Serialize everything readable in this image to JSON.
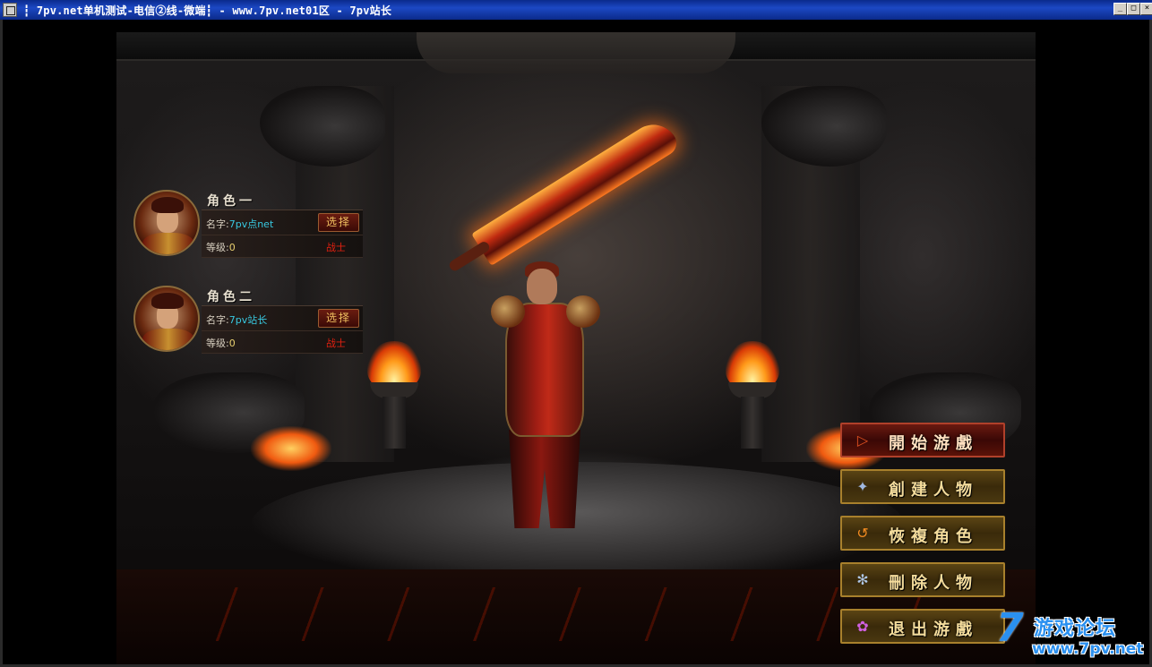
{
  "window": {
    "title": "┇  7pv.net单机测试-电信②线-微端┇ - www.7pv.net01区 - 7pv站长",
    "minimize": "_",
    "maximize": "□",
    "close": "×"
  },
  "characters": [
    {
      "title": "角色一",
      "name_label": "名字:",
      "name": "7pv点net",
      "level_label": "等级:",
      "level": "0",
      "select_label": "选择",
      "job": "战士"
    },
    {
      "title": "角色二",
      "name_label": "名字:",
      "name": "7pv站长",
      "level_label": "等级:",
      "level": "0",
      "select_label": "选择",
      "job": "战士"
    }
  ],
  "menu": {
    "start": "開始游戲",
    "create": "創建人物",
    "restore": "恢複角色",
    "delete": "刪除人物",
    "exit": "退出游戲"
  },
  "watermark": {
    "seven": "7",
    "text": "游戏论坛",
    "url": "www.7pv.net"
  },
  "colors": {
    "title_bar": "#1c48c4",
    "name_value": "#38c8e0",
    "job": "#e02010",
    "menu_text": "#f4dc9c",
    "watermark": "#2a90f0"
  }
}
